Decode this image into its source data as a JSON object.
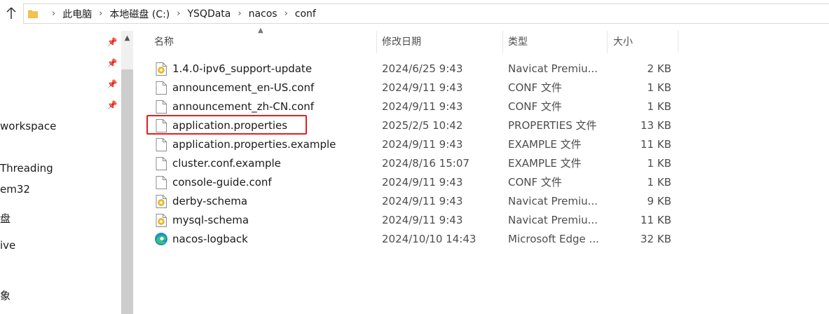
{
  "breadcrumb": {
    "items": [
      "此电脑",
      "本地磁盘 (C:)",
      "YSQData",
      "nacos",
      "conf"
    ]
  },
  "nav": {
    "items": [
      "workspace",
      "Threading",
      "em32",
      "盘",
      "ive",
      "象"
    ]
  },
  "columns": {
    "name": "名称",
    "date": "修改日期",
    "type": "类型",
    "size": "大小"
  },
  "files": [
    {
      "name": "1.4.0-ipv6_support-update",
      "date": "2024/6/25 9:43",
      "type": "Navicat Premiu...",
      "size": "2 KB",
      "icon": "navicat-file-icon"
    },
    {
      "name": "announcement_en-US.conf",
      "date": "2024/9/11 9:43",
      "type": "CONF 文件",
      "size": "1 KB",
      "icon": "file-icon"
    },
    {
      "name": "announcement_zh-CN.conf",
      "date": "2024/9/11 9:43",
      "type": "CONF 文件",
      "size": "1 KB",
      "icon": "file-icon"
    },
    {
      "name": "application.properties",
      "date": "2025/2/5 10:42",
      "type": "PROPERTIES 文件",
      "size": "13 KB",
      "icon": "file-icon"
    },
    {
      "name": "application.properties.example",
      "date": "2024/9/11 9:43",
      "type": "EXAMPLE 文件",
      "size": "11 KB",
      "icon": "file-icon"
    },
    {
      "name": "cluster.conf.example",
      "date": "2024/8/16 15:07",
      "type": "EXAMPLE 文件",
      "size": "1 KB",
      "icon": "file-icon"
    },
    {
      "name": "console-guide.conf",
      "date": "2024/9/11 9:43",
      "type": "CONF 文件",
      "size": "1 KB",
      "icon": "file-icon"
    },
    {
      "name": "derby-schema",
      "date": "2024/9/11 9:43",
      "type": "Navicat Premiu...",
      "size": "9 KB",
      "icon": "navicat-file-icon"
    },
    {
      "name": "mysql-schema",
      "date": "2024/9/11 9:43",
      "type": "Navicat Premiu...",
      "size": "11 KB",
      "icon": "navicat-file-icon"
    },
    {
      "name": "nacos-logback",
      "date": "2024/10/10 14:43",
      "type": "Microsoft Edge ...",
      "size": "32 KB",
      "icon": "edge-file-icon"
    }
  ],
  "colors": {
    "highlight": "#e02020",
    "folder": "#f2c14e"
  }
}
